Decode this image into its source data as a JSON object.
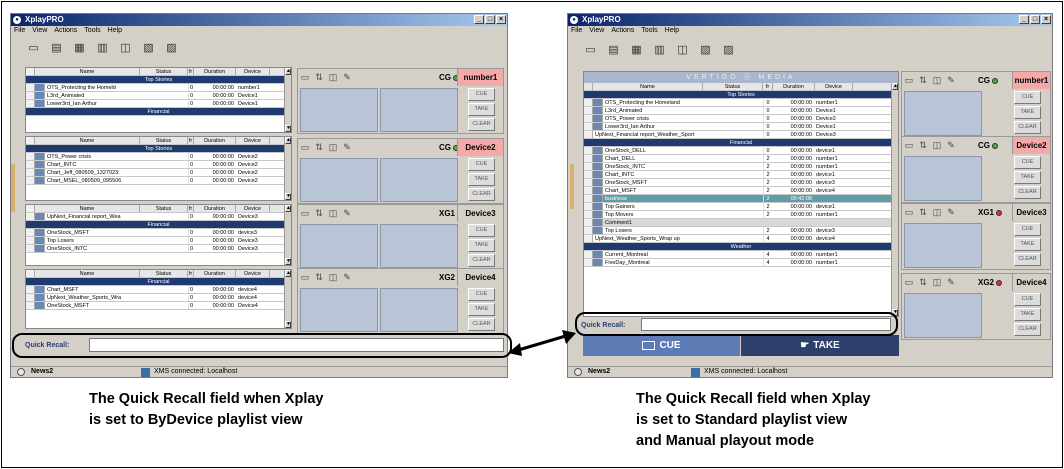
{
  "app_title": "XplayPRO",
  "menu": [
    "File",
    "View",
    "Actions",
    "Tools",
    "Help"
  ],
  "columns": {
    "name": "Name",
    "status": "Status",
    "fr": "fr",
    "duration": "Duration",
    "device": "Device"
  },
  "left": {
    "groups": [
      {
        "section": "Top Stories",
        "rows": [
          {
            "name": "OTS_Protecting the Homeld",
            "fr": "0",
            "dur": "00:00:00",
            "dev": "number1"
          },
          {
            "name": "L3rd_Animated",
            "fr": "0",
            "dur": "00:00:00",
            "dev": "Device1"
          },
          {
            "name": "Lower3rd_Ian Arthur",
            "fr": "0",
            "dur": "00:00:00",
            "dev": "Device1"
          }
        ],
        "section2": "Financial"
      },
      {
        "section": "Top Stories",
        "rows": [
          {
            "name": "OTS_Power crisis",
            "fr": "0",
            "dur": "00:00:00",
            "dev": "Device2"
          },
          {
            "name": "Chart_INTC",
            "fr": "0",
            "dur": "00:00:00",
            "dev": "Device2"
          },
          {
            "name": "Chart_Jeff_080509_1327023:",
            "fr": "0",
            "dur": "00:00:00",
            "dev": "Device2"
          },
          {
            "name": "Chart_MSEL_080509_095506",
            "fr": "0",
            "dur": "00:00:00",
            "dev": "Device2"
          }
        ]
      },
      {
        "prerows": [
          {
            "name": "UpNext_Financial report_Wea",
            "fr": "0",
            "dur": "00:00:00",
            "dev": "Device3"
          }
        ],
        "section": "Financial",
        "rows": [
          {
            "name": "OneStock_MSFT",
            "fr": "0",
            "dur": "00:00:00",
            "dev": "device3"
          },
          {
            "name": "Top Losers",
            "fr": "0",
            "dur": "00:00:00",
            "dev": "Device3"
          },
          {
            "name": "OneStock_INTC",
            "fr": "0",
            "dur": "00:00:00",
            "dev": "Device3"
          }
        ]
      },
      {
        "section": "Financial",
        "rows": [
          {
            "name": "Chart_MSFT",
            "fr": "0",
            "dur": "00:00:00",
            "dev": "device4"
          },
          {
            "name": "UpNext_Weather_Sports_Wra",
            "fr": "0",
            "dur": "00:00:00",
            "dev": "device4"
          },
          {
            "name": "OneStock_MSFT",
            "fr": "0",
            "dur": "00:00:00",
            "dev": "Device4"
          }
        ]
      }
    ],
    "devices": [
      {
        "label": "CG",
        "dot": "#3cb043",
        "name": "number1",
        "name_bg": "#f5a8a8"
      },
      {
        "label": "CG",
        "dot": "#3cb043",
        "name": "Device2",
        "name_bg": "#f5a8a8"
      },
      {
        "label": "XG1",
        "dot": "#e03030",
        "name": "Device3",
        "name_bg": "#d4d0c8"
      },
      {
        "label": "XG2",
        "dot": "#e03030",
        "name": "Device4",
        "name_bg": "#d4d0c8"
      }
    ],
    "quick_recall_label": "Quick Recall:",
    "status_name": "News2",
    "status_text": "XMS connected: Localhost"
  },
  "right": {
    "banner": "VERTIGO ⓧ MEDIA",
    "rows": [
      {
        "type": "sec",
        "name": "Top Stories"
      },
      {
        "name": "OTS_Protecting the Homeland",
        "fr": "0",
        "dur": "00:00:00",
        "dev": "number1"
      },
      {
        "name": "L3rd_Animated",
        "fr": "0",
        "dur": "00:00:00",
        "dev": "Device1"
      },
      {
        "name": "OTS_Power crisis",
        "fr": "0",
        "dur": "00:00:00",
        "dev": "Device2"
      },
      {
        "name": "Lower3rd_Ian Arthur",
        "fr": "0",
        "dur": "00:00:00",
        "dev": "Device1"
      },
      {
        "name": "UpNext_Financial report_Weather_Sport",
        "fr": "0",
        "dur": "00:00:00",
        "dev": "Device3",
        "wide": true
      },
      {
        "type": "sec",
        "name": "Financial"
      },
      {
        "name": "OneStock_DELL",
        "fr": "0",
        "dur": "00:00:00",
        "dev": "device1"
      },
      {
        "name": "Chart_DELL",
        "fr": "2",
        "dur": "00:00:00",
        "dev": "number1"
      },
      {
        "name": "OneStock_INTC",
        "fr": "2",
        "dur": "00:00:00",
        "dev": "number1"
      },
      {
        "name": "Chart_INTC",
        "fr": "2",
        "dur": "00:00:00",
        "dev": "device1"
      },
      {
        "name": "OneStock_MSFT",
        "fr": "2",
        "dur": "00:00:00",
        "dev": "device3"
      },
      {
        "name": "Chart_MSFT",
        "fr": "2",
        "dur": "00:00:00",
        "dev": "device4"
      },
      {
        "name": "business",
        "fr": "2",
        "dur": "00:42:08",
        "dev": "",
        "hl": true
      },
      {
        "name": "Top Gainers",
        "fr": "2",
        "dur": "00:00:00",
        "dev": "device1"
      },
      {
        "name": "Top Movers",
        "fr": "2",
        "dur": "00:00:00",
        "dev": "number1"
      },
      {
        "name": "Comment1",
        "fr": "",
        "dur": "",
        "dev": "",
        "gry": true
      },
      {
        "name": "Top Losers",
        "fr": "2",
        "dur": "00:00:00",
        "dev": "device3"
      },
      {
        "name": "UpNext_Weather_Sports_Wrap up",
        "fr": "4",
        "dur": "00:00:00",
        "dev": "device4",
        "wide": true
      },
      {
        "type": "sec",
        "name": "Weather"
      },
      {
        "name": "Current_Montreal",
        "fr": "4",
        "dur": "00:00:00",
        "dev": "number1"
      },
      {
        "name": "FiveDay_Montreal",
        "fr": "4",
        "dur": "00:00:00",
        "dev": "number1"
      }
    ],
    "devices": [
      {
        "label": "CG",
        "dot": "#3cb043",
        "name": "number1",
        "name_bg": "#f5a8a8"
      },
      {
        "label": "CG",
        "dot": "#3cb043",
        "name": "Device2",
        "name_bg": "#f5a8a8"
      },
      {
        "label": "XG1",
        "dot": "#e03030",
        "name": "Device3",
        "name_bg": "#d4d0c8"
      },
      {
        "label": "XG2",
        "dot": "#e03030",
        "name": "Device4",
        "name_bg": "#d4d0c8"
      }
    ],
    "quick_recall_label": "Quick Recall:",
    "cue_label": "CUE",
    "take_label": "TAKE",
    "status_name": "News2",
    "status_text": "XMS connected: Localhost"
  },
  "buttons": {
    "cue": "CUE",
    "take": "TAKE",
    "clear": "CLEAR"
  },
  "captions": {
    "left": [
      "The Quick Recall field when Xplay",
      "is set to ByDevice playlist view"
    ],
    "right": [
      "The Quick Recall field when Xplay",
      "is set to Standard playlist view",
      "and Manual playout mode"
    ]
  }
}
